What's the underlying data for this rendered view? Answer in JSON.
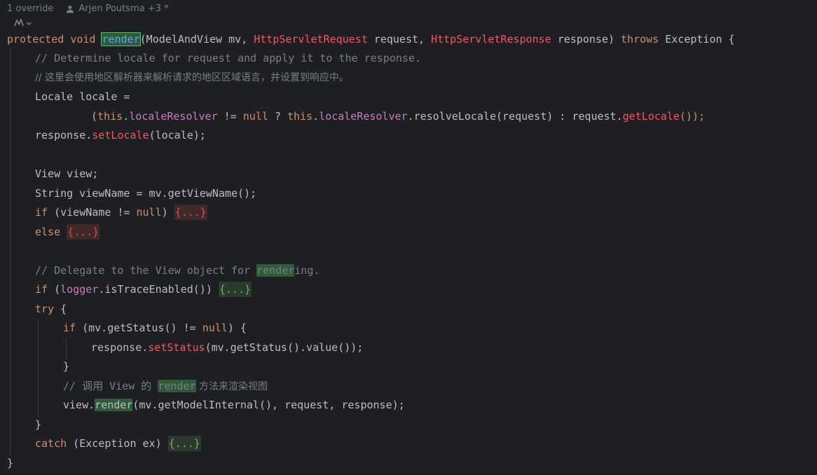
{
  "inlay": {
    "override_count": "1 override",
    "authors": "Arjen Poutsma +3 *"
  },
  "code": {
    "l1": {
      "kw1": "protected",
      "kw2": "void",
      "method": "render",
      "p1": "(ModelAndView mv, ",
      "t2": "HttpServletRequest",
      "p2": " request, ",
      "t3": "HttpServletResponse",
      "p3": " response) ",
      "throws": "throws",
      "p4": " Exception {"
    },
    "l2": "// Determine locale for request and apply it to the response.",
    "l3": "// 这里会使用地区解析器来解析请求的地区区域语言，并设置到响应中。",
    "l4": "Locale locale =",
    "l5": {
      "open": "(",
      "this1": "this",
      "dot1": ".",
      "field1": "localeResolver",
      "neq": " != ",
      "null": "null",
      "q": " ? ",
      "this2": "this",
      "dot2": ".",
      "field2": "localeResolver",
      "call": ".resolveLocale(request) : request.",
      "getLocale": "getLocale",
      "end": "());"
    },
    "l6": {
      "a": "response.",
      "setLocale": "setLocale",
      "b": "(locale);"
    },
    "l8": "View view;",
    "l9": "String viewName = mv.getViewName();",
    "l10": {
      "kw": "if",
      "a": " (viewName != ",
      "null": "null",
      "b": ") ",
      "fold": "{...}"
    },
    "l11": {
      "kw": "else",
      "fold": "{...}"
    },
    "l13": {
      "a": "// Delegate to the View object for ",
      "hl": "render",
      "b": "ing."
    },
    "l14": {
      "kw": "if",
      "a": " (",
      "logger": "logger",
      "b": ".isTraceEnabled()) ",
      "fold": "{...}"
    },
    "l15": {
      "kw": "try",
      "a": " {"
    },
    "l16": {
      "kw": "if",
      "a": " (mv.getStatus() != ",
      "null": "null",
      "b": ") {"
    },
    "l17": {
      "a": "response.",
      "setStatus": "setStatus",
      "b": "(mv.getStatus().value());"
    },
    "l18": "}",
    "l19": {
      "a": "// 调用 View 的 ",
      "hl": "render",
      "b": " 方法来渲染视图"
    },
    "l20": {
      "a": "view.",
      "hl": "render",
      "b": "(mv.getModelInternal(), request, response);"
    },
    "l21": "}",
    "l22": {
      "kw": "catch",
      "a": " (Exception ex) ",
      "fold": "{...}"
    },
    "l23": "}"
  }
}
